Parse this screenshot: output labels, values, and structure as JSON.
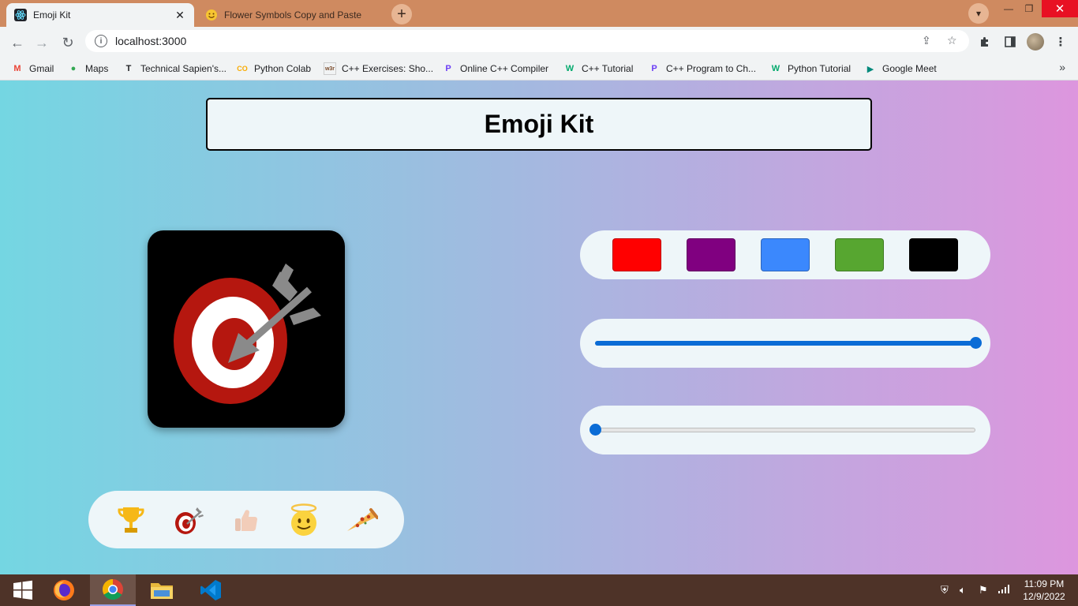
{
  "browser": {
    "tabs": [
      {
        "title": "Emoji Kit",
        "active": true
      },
      {
        "title": "Flower Symbols Copy and Paste",
        "active": false
      }
    ],
    "address": "localhost:3000",
    "bookmarks": [
      {
        "label": "Gmail",
        "icon": "gmail-icon",
        "glyph": "M"
      },
      {
        "label": "Maps",
        "icon": "maps-pin-icon",
        "glyph": "●"
      },
      {
        "label": "Technical Sapien's...",
        "icon": "t-logo-icon",
        "glyph": "T"
      },
      {
        "label": "Python Colab",
        "icon": "colab-icon",
        "glyph": "CO"
      },
      {
        "label": "C++ Exercises: Sho...",
        "icon": "w3r-icon",
        "glyph": "w3r"
      },
      {
        "label": "Online C++ Compiler",
        "icon": "programiz-icon",
        "glyph": "P"
      },
      {
        "label": "C++ Tutorial",
        "icon": "w3schools-icon",
        "glyph": "W"
      },
      {
        "label": "C++ Program to Ch...",
        "icon": "programiz-icon",
        "glyph": "P"
      },
      {
        "label": "Python Tutorial",
        "icon": "w3schools-icon",
        "glyph": "W"
      },
      {
        "label": "Google Meet",
        "icon": "meet-icon",
        "glyph": "▶"
      }
    ]
  },
  "app": {
    "title": "Emoji Kit",
    "selected_emoji": "direct-hit",
    "emoji_tray": [
      {
        "name": "trophy",
        "glyph": "🏆"
      },
      {
        "name": "direct-hit",
        "glyph": "🎯"
      },
      {
        "name": "thumbs-up",
        "glyph": "👍"
      },
      {
        "name": "smiling-face-with-halo",
        "glyph": "😇"
      },
      {
        "name": "pizza",
        "glyph": "🍕"
      }
    ],
    "color_swatches": [
      "#ff0000",
      "#800080",
      "#3b88fd",
      "#57a630",
      "#000000"
    ],
    "slider_1_value": 1.0,
    "slider_2_value": 0.0
  },
  "taskbar": {
    "time": "11:09 PM",
    "date": "12/9/2022"
  }
}
